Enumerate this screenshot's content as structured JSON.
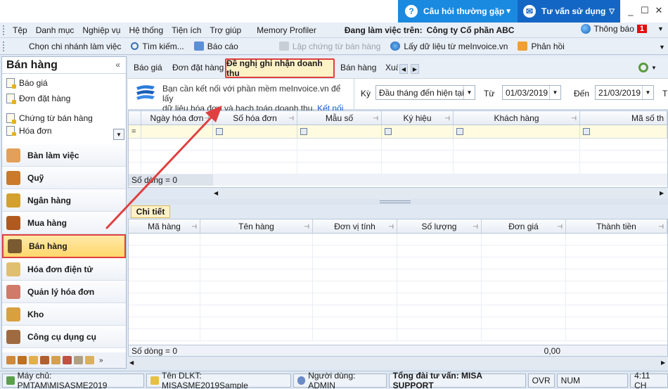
{
  "titlebar": {
    "faq_label": "Câu hỏi thường gặp",
    "consult_label": "Tư vấn sử dụng",
    "minimize": "_",
    "maximize": "☐",
    "close": "✕"
  },
  "menubar": {
    "items": [
      "Tệp",
      "Danh mục",
      "Nghiệp vụ",
      "Hệ thống",
      "Tiện ích",
      "Trợ giúp",
      "Memory Profiler"
    ],
    "working_label": "Đang làm việc trên:",
    "company": "Công ty Cổ phần ABC",
    "notify_label": "Thông báo",
    "notify_count": "1"
  },
  "toolbar": {
    "choose_branch": "Chọn chi nhánh làm việc",
    "search": "Tìm kiếm...",
    "report": "Báo cáo",
    "create_sales_doc": "Lập chứng từ bán hàng",
    "fetch_data": "Lấy dữ liệu từ meInvoice.vn",
    "feedback": "Phản hồi"
  },
  "left": {
    "title": "Bán hàng",
    "collapse": "«",
    "sub_items": [
      "Báo giá",
      "Đơn đặt hàng",
      "Chứng từ bán hàng",
      "Hóa đơn"
    ],
    "modules": [
      "Bàn làm việc",
      "Quỹ",
      "Ngân hàng",
      "Mua hàng",
      "Bán hàng",
      "Hóa đơn điện tử",
      "Quản lý hóa đơn",
      "Kho",
      "Công cụ dụng cụ"
    ]
  },
  "tabs": {
    "items": [
      "Báo giá",
      "Đơn đặt hàng",
      "Đề nghị ghi nhận doanh thu",
      "Bán hàng",
      "Xuấ"
    ]
  },
  "info": {
    "line1": "Bạn cần kết nối với phần mềm meInvoice.vn để lấy",
    "line2": "dữ liệu hóa đơn và hạch toán doanh thu.",
    "link": "Kết nối ngay"
  },
  "filter": {
    "period_label": "Kỳ",
    "period_value": "Đầu tháng đến hiện tại",
    "from_label": "Từ",
    "from_value": "01/03/2019",
    "to_label": "Đến",
    "to_value": "21/03/2019",
    "extra_label": "T"
  },
  "master_grid": {
    "columns": [
      "Ngày hóa đơn",
      "Số hóa đơn",
      "Mẫu số",
      "Ký hiệu",
      "Khách hàng",
      "Mã số th"
    ],
    "filter_op": "=",
    "row_count": "Số dòng = 0"
  },
  "detail": {
    "tab_label": "Chi tiết",
    "columns": [
      "Mã hàng",
      "Tên hàng",
      "Đơn vị tính",
      "Số lượng",
      "Đơn giá",
      "Thành tiền"
    ],
    "row_count": "Số dòng = 0",
    "total_amount": "0,00"
  },
  "statusbar": {
    "server": "Máy chủ: PMTAM\\MISASME2019",
    "db": "Tên DLKT: MISASME2019Sample",
    "user": "Người dùng: ADMIN",
    "hotline": "Tổng đài tư vấn: MISA SUPPORT",
    "ovr": "OVR",
    "num": "NUM",
    "time": "4:11 CH"
  },
  "colors": {
    "accent_blue": "#1a8ae0",
    "highlight_red": "#e04040",
    "active_tab_bg": "#fdf1c6"
  }
}
